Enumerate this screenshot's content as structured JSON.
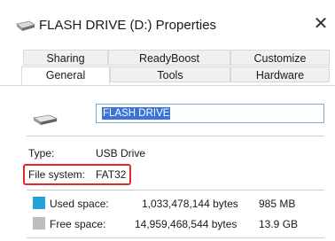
{
  "window": {
    "title": "FLASH DRIVE (D:) Properties",
    "close_glyph": "✕"
  },
  "tabs": {
    "row1": [
      {
        "label": "Sharing"
      },
      {
        "label": "ReadyBoost"
      },
      {
        "label": "Customize"
      }
    ],
    "row2": [
      {
        "label": "General",
        "active": true
      },
      {
        "label": "Tools"
      },
      {
        "label": "Hardware"
      }
    ]
  },
  "general": {
    "drive_name": "FLASH DRIVE",
    "type_label": "Type:",
    "type_value": "USB Drive",
    "fs_label": "File system:",
    "fs_value": "FAT32",
    "used": {
      "label": "Used space:",
      "bytes": "1,033,478,144 bytes",
      "size": "985 MB",
      "color": "#26a0da"
    },
    "free": {
      "label": "Free space:",
      "bytes": "14,959,468,544 bytes",
      "size": "13.9 GB",
      "color": "#bebebe"
    }
  },
  "colors": {
    "highlight": "#e0282e",
    "selection": "#3a74d8"
  }
}
